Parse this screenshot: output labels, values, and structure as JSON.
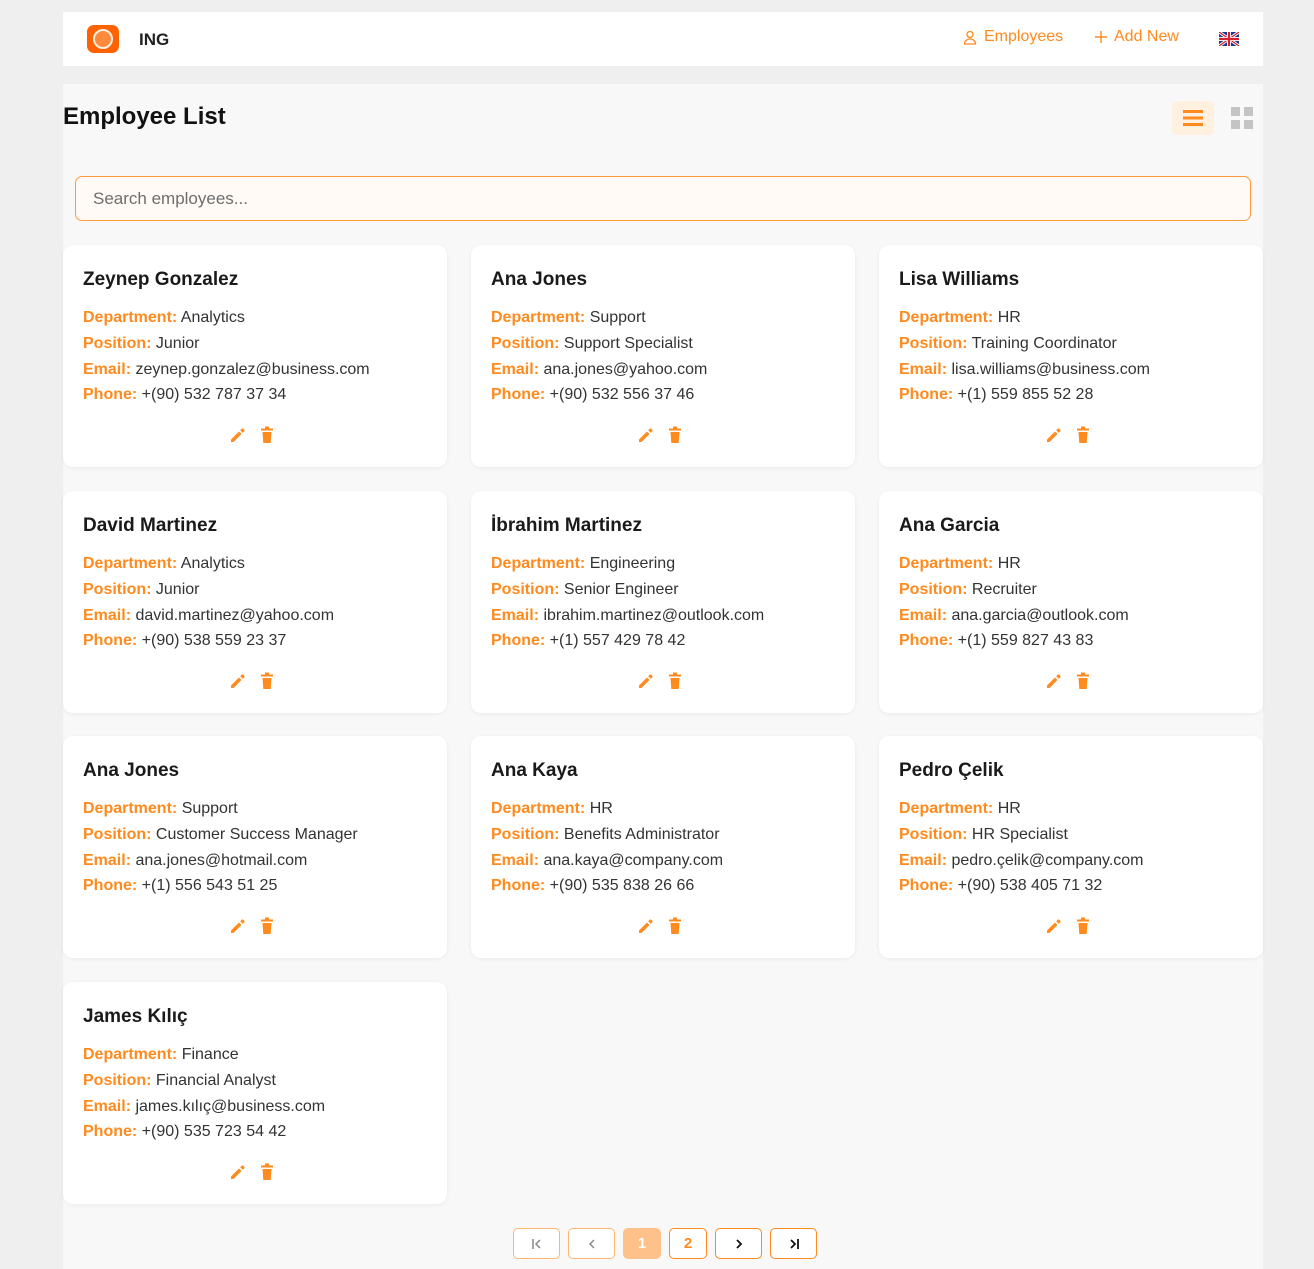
{
  "header": {
    "brand": "ING",
    "nav_employees": "Employees",
    "nav_add_new": "Add New",
    "accent_color": "#ff8a1e"
  },
  "main": {
    "title": "Employee List",
    "search_placeholder": "Search employees..."
  },
  "labels": {
    "department": "Department:",
    "position": "Position:",
    "email": "Email:",
    "phone": "Phone:"
  },
  "employees": [
    {
      "name": "Zeynep Gonzalez",
      "department": "Analytics",
      "position": "Junior",
      "email": "zeynep.gonzalez@business.com",
      "phone": "+(90) 532 787 37 34"
    },
    {
      "name": "Ana Jones",
      "department": "Support",
      "position": "Support Specialist",
      "email": "ana.jones@yahoo.com",
      "phone": "+(90) 532 556 37 46"
    },
    {
      "name": "Lisa Williams",
      "department": "HR",
      "position": "Training Coordinator",
      "email": "lisa.williams@business.com",
      "phone": "+(1) 559 855 52 28"
    },
    {
      "name": "David Martinez",
      "department": "Analytics",
      "position": "Junior",
      "email": "david.martinez@yahoo.com",
      "phone": "+(90) 538 559 23 37"
    },
    {
      "name": "İbrahim Martinez",
      "department": "Engineering",
      "position": "Senior Engineer",
      "email": "ibrahim.martinez@outlook.com",
      "phone": "+(1) 557 429 78 42"
    },
    {
      "name": "Ana Garcia",
      "department": "HR",
      "position": "Recruiter",
      "email": "ana.garcia@outlook.com",
      "phone": "+(1) 559 827 43 83"
    },
    {
      "name": "Ana Jones",
      "department": "Support",
      "position": "Customer Success Manager",
      "email": "ana.jones@hotmail.com",
      "phone": "+(1) 556 543 51 25"
    },
    {
      "name": "Ana Kaya",
      "department": "HR",
      "position": "Benefits Administrator",
      "email": "ana.kaya@company.com",
      "phone": "+(90) 535 838 26 66"
    },
    {
      "name": "Pedro Çelik",
      "department": "HR",
      "position": "HR Specialist",
      "email": "pedro.çelik@company.com",
      "phone": "+(90) 538 405 71 32"
    },
    {
      "name": "James Kılıç",
      "department": "Finance",
      "position": "Financial Analyst",
      "email": "james.kılıç@business.com",
      "phone": "+(90) 535 723 54 42"
    }
  ],
  "pagination": {
    "pages": [
      "1",
      "2"
    ],
    "current": "1"
  }
}
